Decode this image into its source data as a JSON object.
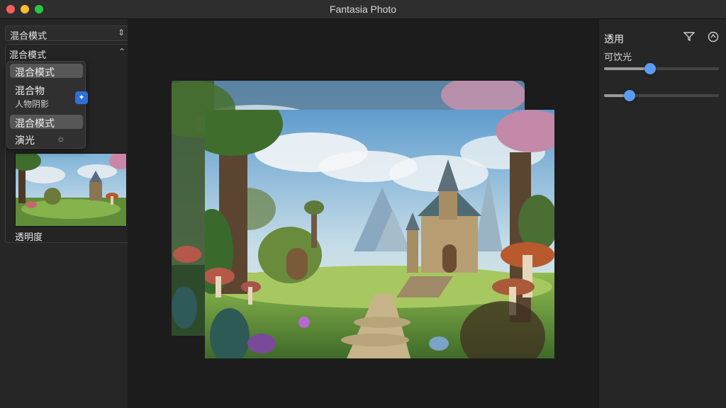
{
  "window": {
    "title": "Fantasia Photo"
  },
  "left_panel": {
    "blend_select": {
      "value": "混合模式",
      "arrows": "⇕"
    },
    "section": {
      "title": "混合模式",
      "chevron": "⌃"
    },
    "menu": {
      "items": [
        {
          "label": "混合模式",
          "selected": true
        },
        {
          "label": "混合物",
          "sublabel": "人物阴影",
          "badge": "✦"
        },
        {
          "label": "混合模式",
          "selected": true
        },
        {
          "label": "演光",
          "icon": "☼"
        }
      ]
    },
    "thumbnail": {
      "icon": "image-thumbnail"
    },
    "footer_label": "透明度"
  },
  "right_panel": {
    "title": "透用",
    "subtitle": "可饮光",
    "icons": [
      "funnel-icon",
      "target-icon"
    ],
    "sliders": [
      {
        "value_fraction": 0.4
      },
      {
        "value_fraction": 0.22
      }
    ]
  },
  "colors": {
    "accent": "#5c9cf2",
    "badge": "#2f6fd6"
  }
}
